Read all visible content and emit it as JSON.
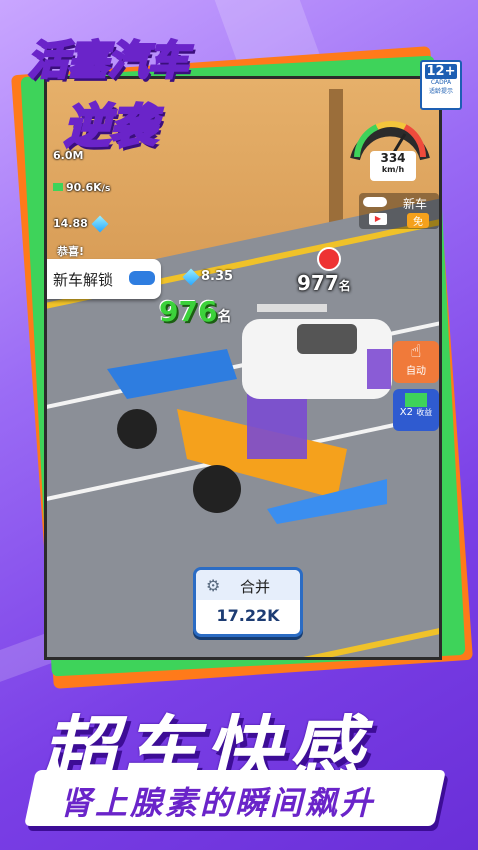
{
  "game": {
    "title_line1": "活塞汽车",
    "title_line2": "逆袭"
  },
  "age_rating": {
    "badge": "12+",
    "org": "CADPA",
    "note": "适龄提示"
  },
  "hud": {
    "top_partial": "6.0M",
    "coins": "90.6K",
    "coins_rate": "/s",
    "gems": "14.88",
    "speed_value": "334",
    "speed_unit": "km/h",
    "new_car_label": "新车",
    "free_label": "免",
    "congrats": "恭喜!",
    "unlock_label": "新车解锁",
    "unlock_gems": "8.35",
    "rank_player": "976",
    "rank_opponent": "977",
    "rank_suffix": "名",
    "auto_label": "自动",
    "x2_label": "X2",
    "x2_sub": "收益",
    "merge_label": "合并",
    "merge_cost": "17.22K"
  },
  "promo": {
    "slogan": "超车快感",
    "subtitle": "肾上腺素的瞬间飙升"
  },
  "colors": {
    "background": "#8c55ef",
    "accent_orange": "#ff7a1a",
    "accent_green": "#3ed35a",
    "rank_green": "#3cd23b",
    "brand_purple": "#6a24c9"
  }
}
